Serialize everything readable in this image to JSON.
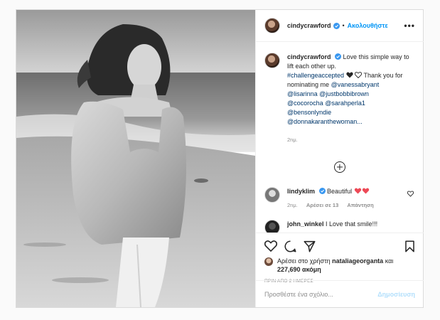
{
  "header": {
    "username": "cindycrawford",
    "separator": "•",
    "follow_label": "Ακολουθήστε",
    "more": "•••"
  },
  "caption": {
    "username": "cindycrawford",
    "text": "Love this simple way to lift each other up.",
    "hashtag": "#challengeaccepted",
    "after_hashtag": "Thank you for nominating me",
    "mentions": [
      "@vanessabryant",
      "@lisarinna",
      "@justbobbibrown",
      "@cocorocha",
      "@sarahperla1",
      "@bensonlyndie",
      "@donnakaranthewoman..."
    ],
    "age": "2nμ."
  },
  "comments": [
    {
      "username": "lindyklim",
      "text": "Beautiful",
      "age": "2nμ.",
      "likes": "Αρέσει σε 13",
      "reply": "Απάντηση"
    },
    {
      "username": "john_winkel",
      "text": "I Love that smile!!!"
    }
  ],
  "likes": {
    "prefix": "Αρέσει στο χρήστη",
    "user": "nataliageorganta",
    "conj": "και",
    "count": "227,690 ακόμη"
  },
  "timestamp": "ΠΡΙΝ ΑΠΟ 2 ΗΜΕΡΕΣ",
  "add_comment": {
    "placeholder": "Προσθέστε ένα σχόλιο...",
    "post_label": "Δημοσίευση"
  },
  "colors": {
    "link_blue": "#0095f6",
    "mention_blue": "#00376b",
    "verified": "#3897f0",
    "heart_red": "#ed4956"
  }
}
